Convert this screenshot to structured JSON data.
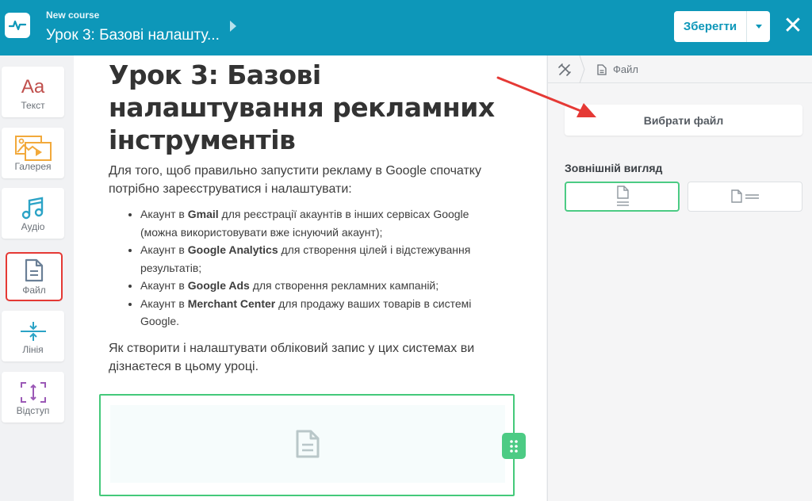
{
  "header": {
    "course_name": "New course",
    "lesson_title": "Урок 3: Базові налашту...",
    "save_label": "Зберегти",
    "close_icon": "close-icon",
    "colors": {
      "bar": "#0d97b9",
      "accent": "#4ccb84",
      "highlight": "#e53935"
    }
  },
  "tools": [
    {
      "label": "Текст",
      "icon": "text-icon"
    },
    {
      "label": "Галерея",
      "icon": "gallery-icon"
    },
    {
      "label": "Аудіо",
      "icon": "audio-icon"
    },
    {
      "label": "Файл",
      "icon": "file-icon"
    },
    {
      "label": "Лінія",
      "icon": "line-icon"
    },
    {
      "label": "Відступ",
      "icon": "spacing-icon"
    }
  ],
  "document": {
    "title": "Урок 3: Базові налаштування рекламних інструментів",
    "intro": "Для того, щоб правильно запустити рекламу в Google спочатку потрібно зареєструватися і налаштувати:",
    "bullets": [
      {
        "pre": "Акаунт в ",
        "bold": "Gmail",
        "post": " для реєстрації акаунтів в інших сервісах Google (можна використовувати вже існуючий акаунт);"
      },
      {
        "pre": "Акаунт в ",
        "bold": "Google Analytics",
        "post": " для створення цілей і відстежування результатів;"
      },
      {
        "pre": "Акаунт в ",
        "bold": "Google Ads",
        "post": " для створення рекламних кампаній;"
      },
      {
        "pre": "Акаунт в ",
        "bold": "Merchant Center",
        "post": " для продажу ваших товарів в системі Google."
      }
    ],
    "outro": "Як створити і налаштувати обліковий запис у цих системах ви дізнаєтеся в цьому уроці."
  },
  "panel": {
    "breadcrumb_label": "Файл",
    "choose_file_label": "Вибрати файл",
    "appearance_title": "Зовнішній вигляд"
  }
}
